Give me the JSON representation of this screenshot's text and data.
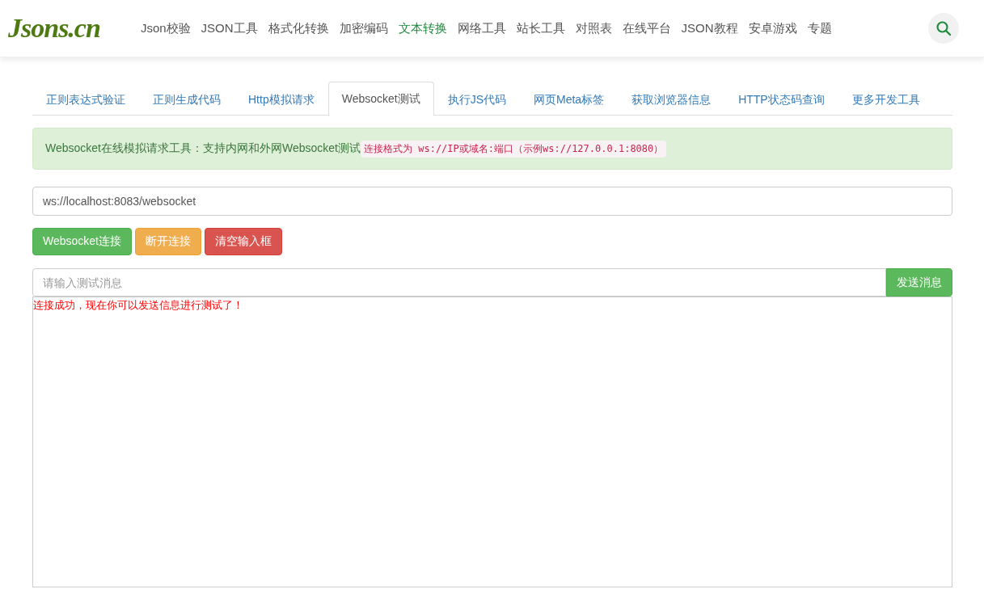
{
  "logo": "Jsons.cn",
  "nav": [
    {
      "label": "Json校验",
      "selected": false
    },
    {
      "label": "JSON工具",
      "selected": false
    },
    {
      "label": "格式化转换",
      "selected": false
    },
    {
      "label": "加密编码",
      "selected": false
    },
    {
      "label": "文本转换",
      "selected": true
    },
    {
      "label": "网络工具",
      "selected": false
    },
    {
      "label": "站长工具",
      "selected": false
    },
    {
      "label": "对照表",
      "selected": false
    },
    {
      "label": "在线平台",
      "selected": false
    },
    {
      "label": "JSON教程",
      "selected": false
    },
    {
      "label": "安卓游戏",
      "selected": false
    },
    {
      "label": "专题",
      "selected": false
    }
  ],
  "tabs": [
    {
      "label": "正则表达式验证",
      "selected": false
    },
    {
      "label": "正则生成代码",
      "selected": false
    },
    {
      "label": "Http模拟请求",
      "selected": false
    },
    {
      "label": "Websocket测试",
      "selected": true
    },
    {
      "label": "执行JS代码",
      "selected": false
    },
    {
      "label": "网页Meta标签",
      "selected": false
    },
    {
      "label": "获取浏览器信息",
      "selected": false
    },
    {
      "label": "HTTP状态码查询",
      "selected": false
    },
    {
      "label": "更多开发工具",
      "selected": false
    }
  ],
  "alert": {
    "text": "Websocket在线模拟请求工具：支持内网和外网Websocket测试",
    "code": "连接格式为 ws://IP或域名:端口（示例ws://127.0.0.1:8080）"
  },
  "url_field": {
    "value": "ws://localhost:8083/websocket"
  },
  "buttons": [
    {
      "label": "Websocket连接",
      "kind": "success"
    },
    {
      "label": "断开连接",
      "kind": "warning"
    },
    {
      "label": "清空输入框",
      "kind": "danger"
    }
  ],
  "message_field": {
    "placeholder": "请输入测试消息"
  },
  "send_button": "发送消息",
  "log": [
    "连接成功，现在你可以发送信息进行测试了！"
  ]
}
